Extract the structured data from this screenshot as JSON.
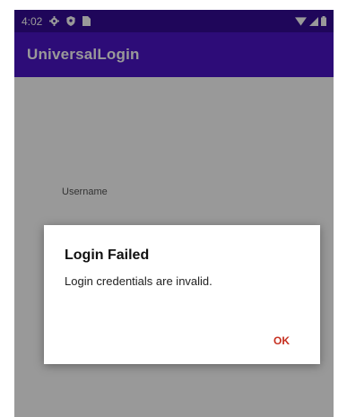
{
  "status_bar": {
    "time": "4:02",
    "icons": [
      "settings-icon",
      "shield-icon",
      "sim-card-icon",
      "wifi-icon",
      "signal-icon",
      "battery-icon"
    ]
  },
  "app_bar": {
    "title": "UniversalLogin"
  },
  "form": {
    "username_label": "Username",
    "username_value": ""
  },
  "dialog": {
    "title": "Login Failed",
    "message": "Login credentials are invalid.",
    "ok_label": "OK"
  },
  "colors": {
    "status_bar": "#340a96",
    "app_bar": "#4c14c8",
    "ok_button": "#c62f1f"
  }
}
